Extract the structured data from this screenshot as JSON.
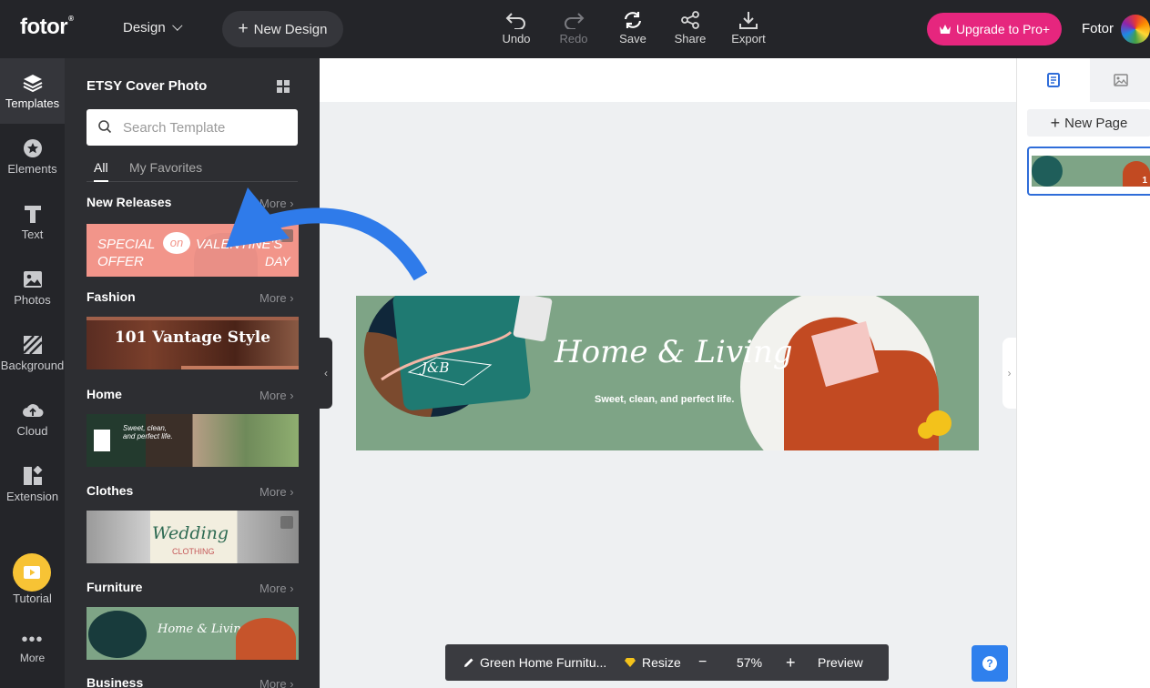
{
  "app": {
    "logo": "fotor",
    "logo_mark": "®",
    "design_menu": "Design",
    "new_design": "New Design",
    "user": "Fotor",
    "upgrade": "Upgrade to Pro+"
  },
  "toolbar": {
    "undo": "Undo",
    "redo": "Redo",
    "save": "Save",
    "share": "Share",
    "export": "Export"
  },
  "nav": {
    "templates": "Templates",
    "elements": "Elements",
    "text": "Text",
    "photos": "Photos",
    "background": "Background",
    "cloud": "Cloud",
    "extension": "Extension",
    "tutorial": "Tutorial",
    "more": "More"
  },
  "panel": {
    "title": "ETSY Cover Photo",
    "search_placeholder": "Search Template",
    "tab_all": "All",
    "tab_favorites": "My Favorites",
    "more_label": "More",
    "sections": {
      "new_releases": {
        "title": "New Releases",
        "t1": "SPECIAL",
        "t2": "on",
        "t3": "VALENTINE'S",
        "t4": "OFFER",
        "t5": "DAY"
      },
      "fashion": {
        "title": "Fashion",
        "t1": "101 Vantage Style"
      },
      "home": {
        "title": "Home",
        "t1": "Sweet, clean,",
        "t2": "and perfect life."
      },
      "clothes": {
        "title": "Clothes",
        "t1": "Wedding",
        "t2": "CLOTHING"
      },
      "furniture": {
        "title": "Furniture",
        "t1": "Home & Living"
      },
      "business": {
        "title": "Business"
      }
    }
  },
  "canvas": {
    "title": "Home & Living",
    "subtitle": "Sweet, clean, and perfect life.",
    "monogram": "J&B"
  },
  "right_panel": {
    "new_page": "New Page",
    "page_number": "1"
  },
  "bottom": {
    "file_name": "Green Home Furnitu...",
    "resize": "Resize",
    "zoom": "57%",
    "minus": "−",
    "plus": "+",
    "preview": "Preview",
    "help": "?"
  },
  "colors": {
    "accent_pink": "#e6267e",
    "banner_green": "#7ea486",
    "annotation_blue": "#2f7bea",
    "help_blue": "#2f80ed"
  }
}
